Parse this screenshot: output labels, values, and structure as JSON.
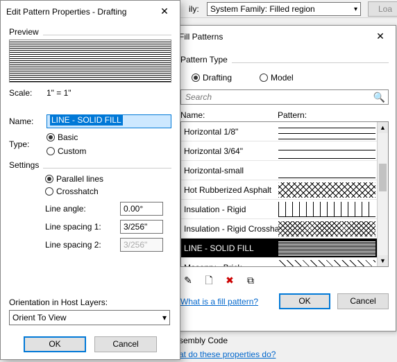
{
  "bg": {
    "family_label_suffix": "ily:",
    "family_value": "System Family: Filled region",
    "load_btn": "Loa",
    "assembly_label": "sembly Code",
    "help_link": "at do these properties do?"
  },
  "fill": {
    "title": "Fill Patterns",
    "close": "✕",
    "pattern_type_label": "Pattern Type",
    "radio_drafting": "Drafting",
    "radio_model": "Model",
    "search_placeholder": "Search",
    "col_name": "Name:",
    "col_pattern": "Pattern:",
    "items": [
      {
        "name": "Horizontal 1/8\"",
        "swatch": "sw-h18"
      },
      {
        "name": "Horizontal 3/64\"",
        "swatch": "sw-h364"
      },
      {
        "name": "Horizontal-small",
        "swatch": "sw-hsmall"
      },
      {
        "name": "Hot Rubberized Asphalt",
        "swatch": "sw-hot"
      },
      {
        "name": "Insulation - Rigid",
        "swatch": "sw-ins"
      },
      {
        "name": "Insulation - Rigid Crossha",
        "swatch": "sw-insx"
      },
      {
        "name": "LINE - SOLID FILL",
        "swatch": "sw-solid",
        "selected": true
      },
      {
        "name": "Masonry - Brick",
        "swatch": "sw-brick"
      }
    ],
    "tools": {
      "edit": "✎",
      "new": "🗋",
      "delete": "✖",
      "dup": "⧉"
    },
    "whatis_link": "What is a fill pattern?",
    "ok": "OK",
    "cancel": "Cancel"
  },
  "edit": {
    "title": "Edit Pattern Properties - Drafting",
    "close": "✕",
    "preview_label": "Preview",
    "scale_label": "Scale:",
    "scale_value": "1\" = 1\"",
    "name_label": "Name:",
    "name_value": "LINE - SOLID FILL",
    "type_label": "Type:",
    "radio_basic": "Basic",
    "radio_custom": "Custom",
    "settings_label": "Settings",
    "radio_parallel": "Parallel lines",
    "radio_crosshatch": "Crosshatch",
    "angle_label": "Line angle:",
    "angle_value": "0.00°",
    "spacing1_label": "Line spacing 1:",
    "spacing1_value": "3/256\"",
    "spacing2_label": "Line spacing 2:",
    "spacing2_value": "3/256\"",
    "orient_label": "Orientation in Host Layers:",
    "orient_value": "Orient To View",
    "ok": "OK",
    "cancel": "Cancel"
  }
}
